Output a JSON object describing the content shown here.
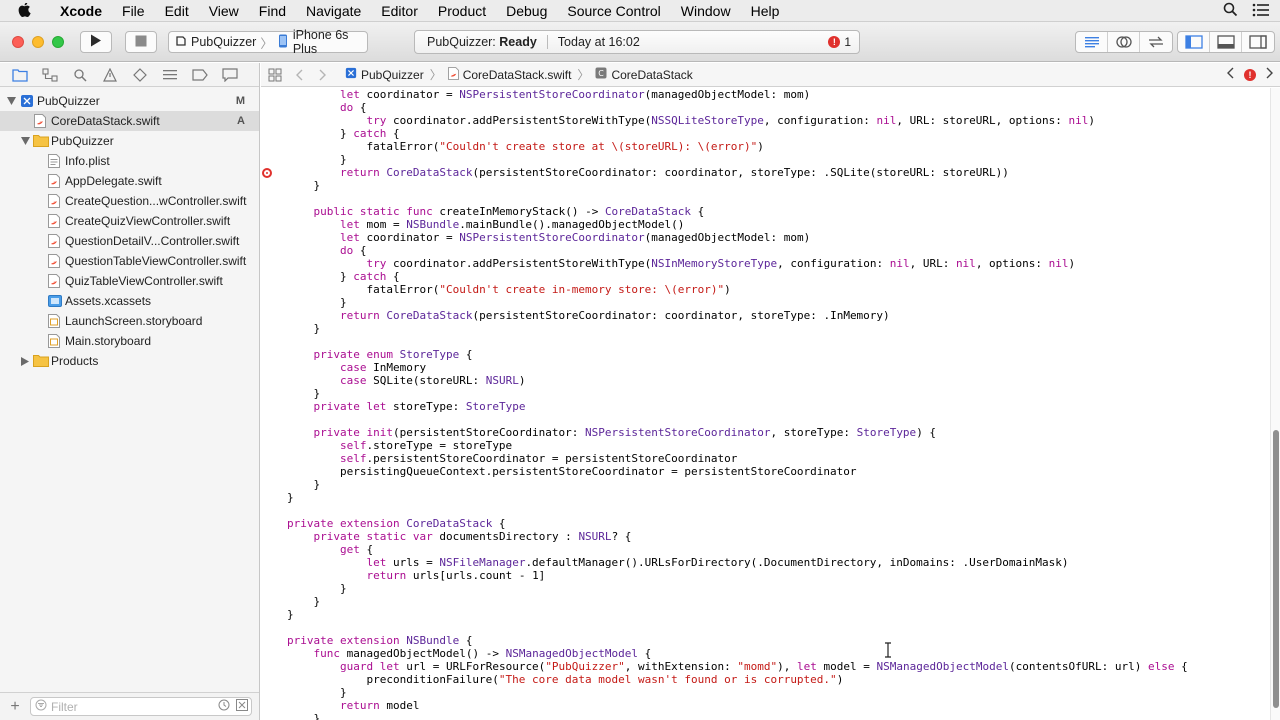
{
  "menubar": {
    "app": "Xcode",
    "items": [
      "File",
      "Edit",
      "View",
      "Find",
      "Navigate",
      "Editor",
      "Product",
      "Debug",
      "Source Control",
      "Window",
      "Help"
    ]
  },
  "toolbar": {
    "scheme": "PubQuizzer",
    "device": "iPhone 6s Plus",
    "status_project": "PubQuizzer:",
    "status_state": "Ready",
    "status_time": "Today at 16:02",
    "error_count": "1"
  },
  "navigator": {
    "project": "PubQuizzer",
    "project_badge": "M",
    "selected_file": "CoreDataStack.swift",
    "selected_badge": "A",
    "group": "PubQuizzer",
    "files": [
      "Info.plist",
      "AppDelegate.swift",
      "CreateQuestion...wController.swift",
      "CreateQuizViewController.swift",
      "QuestionDetailV...Controller.swift",
      "QuestionTableViewController.swift",
      "QuizTableViewController.swift",
      "Assets.xcassets",
      "LaunchScreen.storyboard",
      "Main.storyboard"
    ],
    "products_group": "Products",
    "filter_placeholder": "Filter"
  },
  "jumpbar": {
    "project": "PubQuizzer",
    "file": "CoreDataStack.swift",
    "symbol": "CoreDataStack"
  },
  "colors": {
    "keyword": "#aa0d91",
    "type": "#5c2699",
    "string": "#c41a16",
    "class": "#3f6e74",
    "error": "#e0312d"
  },
  "icons": [
    "apple-icon",
    "search-icon",
    "menu-list-icon",
    "run-icon",
    "stop-icon",
    "error-icon",
    "folder-icon",
    "swift-file-icon",
    "plist-icon",
    "assets-icon",
    "storyboard-icon",
    "breakpoint-icon"
  ],
  "code": [
    "        let coordinator = NSPersistentStoreCoordinator(managedObjectModel: mom)",
    "        do {",
    "            try coordinator.addPersistentStoreWithType(NSSQLiteStoreType, configuration: nil, URL: storeURL, options: nil)",
    "        } catch {",
    "            fatalError(\"Couldn't create store at \\(storeURL): \\(error)\")",
    "        }",
    "        return CoreDataStack(persistentStoreCoordinator: coordinator, storeType: .SQLite(storeURL: storeURL))",
    "    }",
    "",
    "    public static func createInMemoryStack() -> CoreDataStack {",
    "        let mom = NSBundle.mainBundle().managedObjectModel()",
    "        let coordinator = NSPersistentStoreCoordinator(managedObjectModel: mom)",
    "        do {",
    "            try coordinator.addPersistentStoreWithType(NSInMemoryStoreType, configuration: nil, URL: nil, options: nil)",
    "        } catch {",
    "            fatalError(\"Couldn't create in-memory store: \\(error)\")",
    "        }",
    "        return CoreDataStack(persistentStoreCoordinator: coordinator, storeType: .InMemory)",
    "    }",
    "",
    "    private enum StoreType {",
    "        case InMemory",
    "        case SQLite(storeURL: NSURL)",
    "    }",
    "    private let storeType: StoreType",
    "",
    "    private init(persistentStoreCoordinator: NSPersistentStoreCoordinator, storeType: StoreType) {",
    "        self.storeType = storeType",
    "        self.persistentStoreCoordinator = persistentStoreCoordinator",
    "        persistingQueueContext.persistentStoreCoordinator = persistentStoreCoordinator",
    "    }",
    "}",
    "",
    "private extension CoreDataStack {",
    "    private static var documentsDirectory : NSURL? {",
    "        get {",
    "            let urls = NSFileManager.defaultManager().URLsForDirectory(.DocumentDirectory, inDomains: .UserDomainMask)",
    "            return urls[urls.count - 1]",
    "        }",
    "    }",
    "}",
    "",
    "private extension NSBundle {",
    "    func managedObjectModel() -> NSManagedObjectModel {",
    "        guard let url = URLForResource(\"PubQuizzer\", withExtension: \"momd\"), let model = NSManagedObjectModel(contentsOfURL: url) else {",
    "            preconditionFailure(\"The core data model wasn't found or is corrupted.\")",
    "        }",
    "        return model",
    "    }"
  ]
}
